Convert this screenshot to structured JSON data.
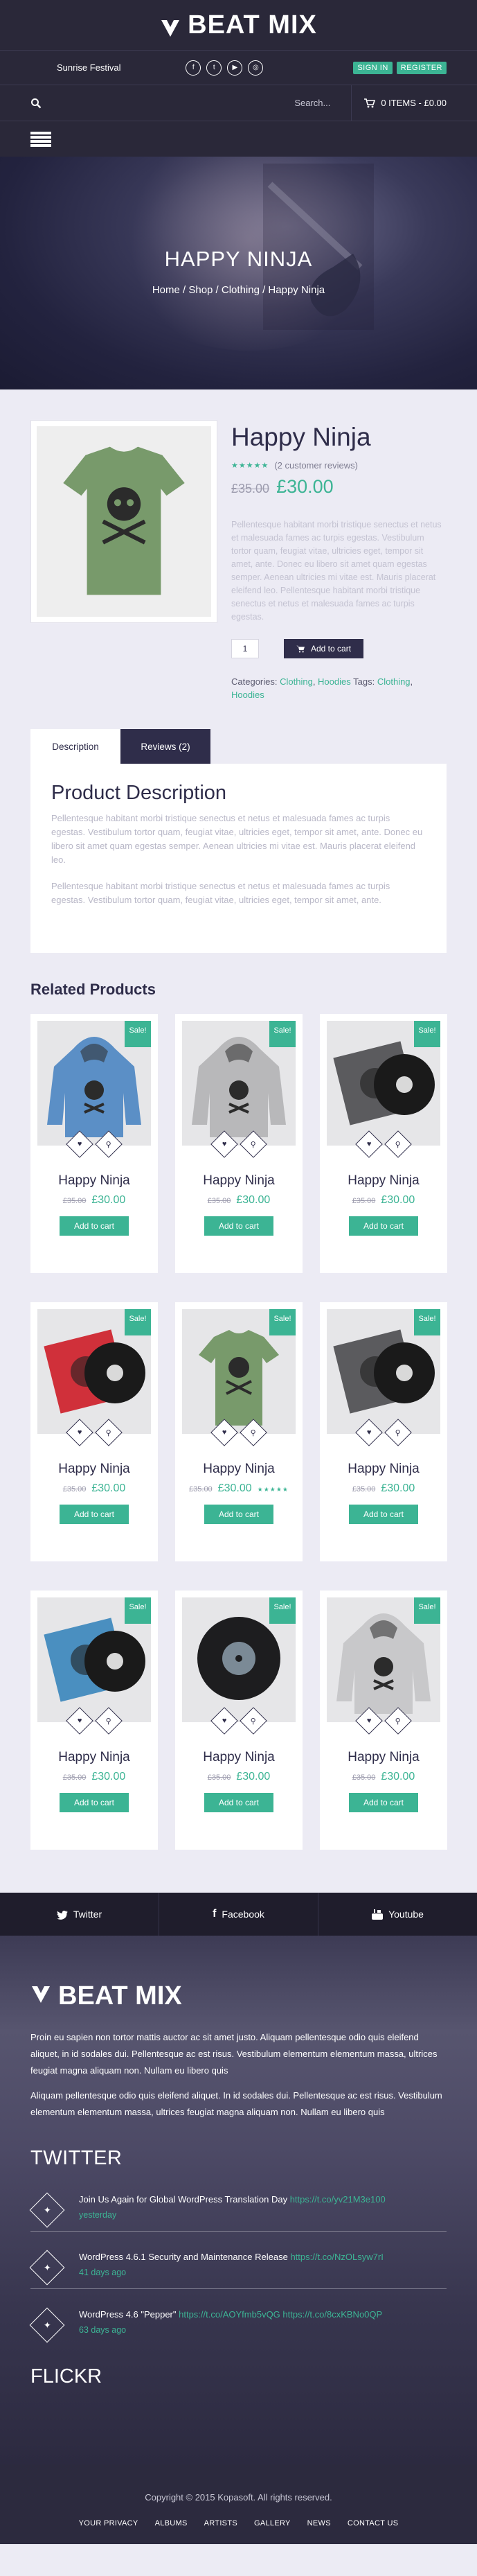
{
  "header": {
    "logo": "BEAT MIX",
    "festival": "Sunrise Festival",
    "socials": [
      "f",
      "t",
      "y",
      "i"
    ],
    "signin": "SIGN IN",
    "register": "REGISTER",
    "search": "Search...",
    "cart": "0 ITEMS - £0.00"
  },
  "hero": {
    "title": "HAPPY NINJA",
    "breadcrumb": "Home / Shop / Clothing / Happy Ninja"
  },
  "product": {
    "title": "Happy Ninja",
    "reviews": "(2 customer reviews)",
    "old_price": "£35.00",
    "price": "£30.00",
    "description": "Pellentesque habitant morbi tristique senectus et netus et malesuada fames ac turpis egestas. Vestibulum tortor quam, feugiat vitae, ultricies eget, tempor sit amet, ante. Donec eu libero sit amet quam egestas semper. Aenean ultricies mi vitae est. Mauris placerat eleifend leo. Pellentesque habitant morbi tristique senectus et netus et malesuada fames ac turpis egestas.",
    "qty": "1",
    "add_to_cart": "Add to cart",
    "categories_label": "Categories:",
    "cat1": "Clothing",
    "cat2": "Hoodies",
    "tags_label": "Tags:",
    "tag1": "Clothing",
    "tag2": "Hoodies"
  },
  "tabs": {
    "description": "Description",
    "reviews": "Reviews (2)",
    "heading": "Product Description",
    "p1": "Pellentesque habitant morbi tristique senectus et netus et malesuada fames ac turpis egestas. Vestibulum tortor quam, feugiat vitae, ultricies eget, tempor sit amet, ante. Donec eu libero sit amet quam egestas semper. Aenean ultricies mi vitae est. Mauris placerat eleifend leo.",
    "p2": "Pellentesque habitant morbi tristique senectus et netus et malesuada fames ac turpis egestas. Vestibulum tortor quam, feugiat vitae, ultricies eget, tempor sit amet, ante."
  },
  "related": {
    "title": "Related Products",
    "sale": "Sale!",
    "items": [
      {
        "name": "Happy Ninja",
        "old": "£35.00",
        "price": "£30.00",
        "btn": "Add to cart",
        "kind": "hoodie-blue"
      },
      {
        "name": "Happy Ninja",
        "old": "£35.00",
        "price": "£30.00",
        "btn": "Add to cart",
        "kind": "hoodie-grey"
      },
      {
        "name": "Happy Ninja",
        "old": "£35.00",
        "price": "£30.00",
        "btn": "Add to cart",
        "kind": "vinyl-grey"
      },
      {
        "name": "Happy Ninja",
        "old": "£35.00",
        "price": "£30.00",
        "btn": "Add to cart",
        "kind": "vinyl-red"
      },
      {
        "name": "Happy Ninja",
        "old": "£35.00",
        "price": "£30.00",
        "btn": "Add to cart",
        "kind": "tshirt-green"
      },
      {
        "name": "Happy Ninja",
        "old": "£35.00",
        "price": "£30.00",
        "btn": "Add to cart",
        "kind": "vinyl-grey2"
      },
      {
        "name": "Happy Ninja",
        "old": "£35.00",
        "price": "£30.00",
        "btn": "Add to cart",
        "kind": "vinyl-blue"
      },
      {
        "name": "Happy Ninja",
        "old": "£35.00",
        "price": "£30.00",
        "btn": "Add to cart",
        "kind": "cd-dark"
      },
      {
        "name": "Happy Ninja",
        "old": "£35.00",
        "price": "£30.00",
        "btn": "Add to cart",
        "kind": "hoodie-grey2"
      }
    ]
  },
  "social_strip": {
    "twitter": "Twitter",
    "facebook": "Facebook",
    "youtube": "Youtube"
  },
  "footer": {
    "logo": "BEAT MIX",
    "p1": "Proin eu sapien non tortor mattis auctor ac sit amet justo. Aliquam pellentesque odio quis eleifend aliquet, in id sodales dui. Pellentesque ac est risus. Vestibulum elementum elementum massa, ultrices feugiat magna aliquam non. Nullam eu libero quis",
    "p2": "Aliquam pellentesque odio quis eleifend aliquet. In id sodales dui. Pellentesque ac est risus. Vestibulum elementum elementum massa, ultrices feugiat magna aliquam non. Nullam eu libero quis",
    "twitter_heading": "TWITTER",
    "tweets": [
      {
        "text": "Join Us Again for Global WordPress Translation Day ",
        "link": "https://t.co/yv21M3e100",
        "time": "yesterday"
      },
      {
        "text": "WordPress 4.6.1 Security and Maintenance Release ",
        "link": "https://t.co/NzOLsyw7rI",
        "time": "41 days ago"
      },
      {
        "text": "WordPress 4.6 \"Pepper\" ",
        "link": "https://t.co/AOYfmb5vQG https://t.co/8cxKBNo0QP",
        "time": "63 days ago"
      }
    ],
    "flickr_heading": "FLICKR",
    "copyright": "Copyright © 2015 Kopasoft. All rights reserved.",
    "nav": [
      "YOUR PRIVACY",
      "ALBUMS",
      "ARTISTS",
      "GALLERY",
      "NEWS",
      "CONTACT US"
    ]
  },
  "colors": {
    "accent": "#3cb494",
    "dark": "#2a2839",
    "navy": "#2f2d4a",
    "bg": "#ecebf4"
  }
}
